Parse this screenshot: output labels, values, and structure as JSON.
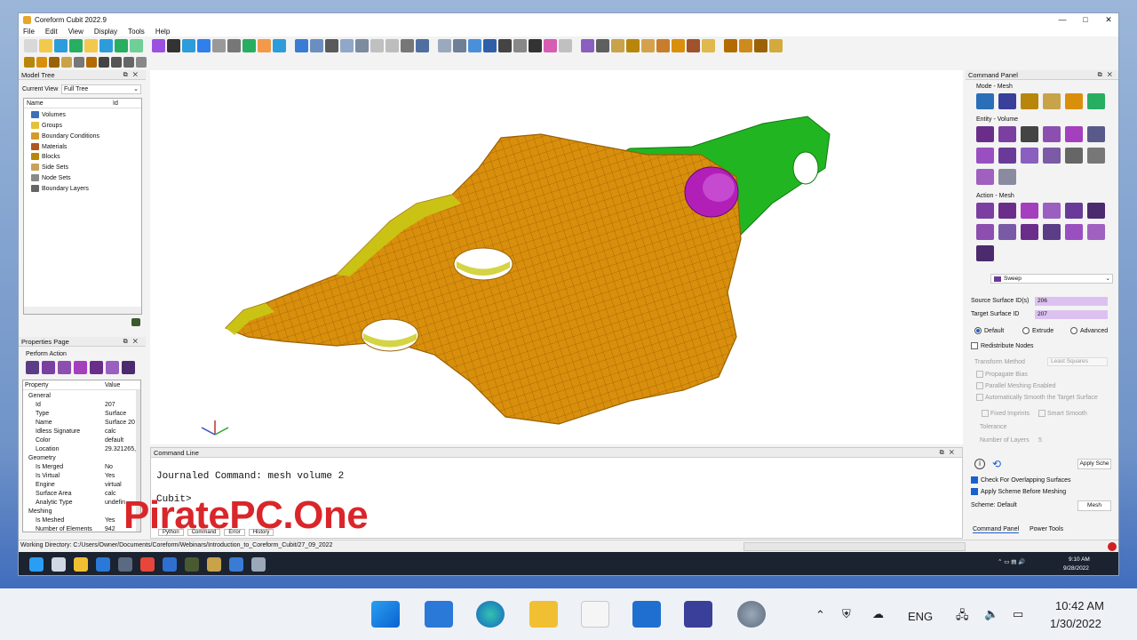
{
  "window": {
    "title": "Coreform Cubit 2022.9",
    "controls": [
      "—",
      "□",
      "✕"
    ]
  },
  "menu": [
    "File",
    "Edit",
    "View",
    "Display",
    "Tools",
    "Help"
  ],
  "model_tree": {
    "title": "Model Tree",
    "current_view_label": "Current View",
    "current_view_value": "Full Tree",
    "col_name": "Name",
    "col_id": "Id",
    "items": [
      "Volumes",
      "Groups",
      "Boundary Conditions",
      "Materials",
      "Blocks",
      "Side Sets",
      "Node Sets",
      "Boundary Layers"
    ]
  },
  "properties": {
    "title": "Properties Page",
    "perform_action": "Perform Action",
    "col_property": "Property",
    "col_value": "Value",
    "rows": [
      {
        "k": "General",
        "v": "",
        "group": true
      },
      {
        "k": "Id",
        "v": "207"
      },
      {
        "k": "Type",
        "v": "Surface"
      },
      {
        "k": "Name",
        "v": "Surface 20"
      },
      {
        "k": "Idless Signature",
        "v": "calc"
      },
      {
        "k": "Color",
        "v": "default"
      },
      {
        "k": "Location",
        "v": "29.321265,"
      },
      {
        "k": "Geometry",
        "v": "",
        "group": true
      },
      {
        "k": "Is Merged",
        "v": "No"
      },
      {
        "k": "Is Virtual",
        "v": "Yes"
      },
      {
        "k": "Engine",
        "v": "virtual"
      },
      {
        "k": "Surface Area",
        "v": "calc"
      },
      {
        "k": "Analytic Type",
        "v": "undefin"
      },
      {
        "k": "Meshing",
        "v": "",
        "group": true
      },
      {
        "k": "Is Meshed",
        "v": "Yes"
      },
      {
        "k": "Number of Elements",
        "v": "942"
      }
    ]
  },
  "command_line": {
    "title": "Command Line",
    "line1": "Journaled Command: mesh volume 2",
    "prompt": "Cubit>",
    "tabs": [
      "Python",
      "Command",
      "Error",
      "History"
    ]
  },
  "status": {
    "working_directory": "Working Directory: C:/Users/Owner/Documents/Coreform/Webinars/Introduction_to_Coreform_Cubit/27_09_2022"
  },
  "watermark": "PiratePC.One",
  "command_panel": {
    "title": "Command Panel",
    "mode_label": "Mode - Mesh",
    "entity_label": "Entity - Volume",
    "action_label": "Action - Mesh",
    "scheme_dropdown": "Sweep",
    "source_label": "Source Surface ID(s)",
    "source_value": "206",
    "target_label": "Target Surface ID",
    "target_value": "207",
    "radio_default": "Default",
    "radio_extrude": "Extrude",
    "radio_advanced": "Advanced",
    "redistribute": "Redistribute Nodes",
    "transform_method": "Transform Method",
    "transform_value": "Least Squares",
    "propagate_bias": "Propagate Bias",
    "parallel_meshing": "Parallel Meshing Enabled",
    "auto_smooth": "Automatically Smooth the Target Surface",
    "fixed_imprints": "Fixed Imprints",
    "smart_smooth": "Smart Smooth",
    "tolerance": "Tolerance",
    "num_layers_label": "Number of Layers",
    "num_layers_value": "5",
    "apply_scheme": "Apply Sche",
    "check_overlap": "Check For Overlapping Surfaces",
    "apply_before_mesh": "Apply Scheme Before Meshing",
    "scheme_status": "Scheme: Default",
    "mesh_button": "Mesh",
    "tab_command": "Command Panel",
    "tab_power": "Power Tools"
  },
  "inner_tray": {
    "time": "9:10 AM",
    "date": "9/28/2022"
  },
  "taskbar": {
    "language": "ENG",
    "time": "10:42 AM",
    "date": "1/30/2022"
  },
  "colors": {
    "mesh_orange": "#d98f0c",
    "green_part": "#22b522",
    "purple_cyl": "#b21fb8",
    "taskbar_bg": "#eef1f6"
  }
}
